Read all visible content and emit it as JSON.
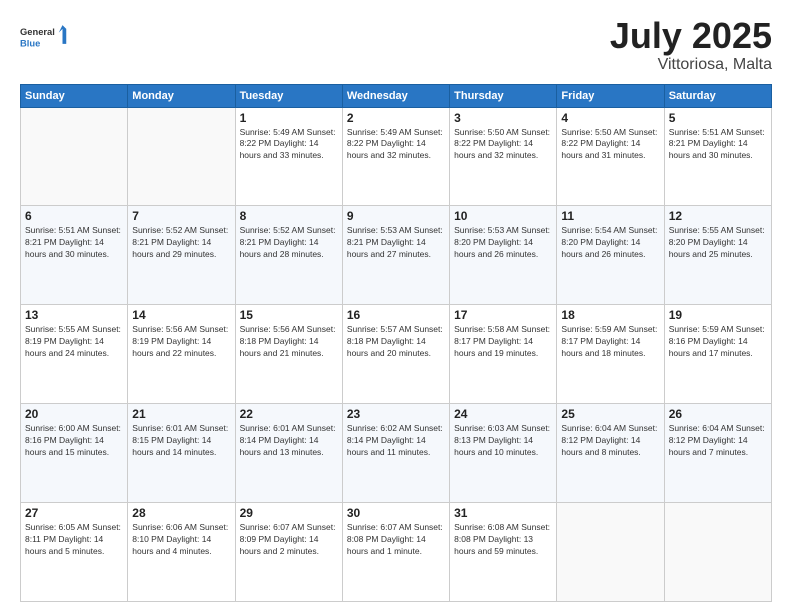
{
  "header": {
    "logo_line1": "General",
    "logo_line2": "Blue",
    "month": "July 2025",
    "location": "Vittoriosa, Malta"
  },
  "weekdays": [
    "Sunday",
    "Monday",
    "Tuesday",
    "Wednesday",
    "Thursday",
    "Friday",
    "Saturday"
  ],
  "weeks": [
    [
      {
        "day": "",
        "info": ""
      },
      {
        "day": "",
        "info": ""
      },
      {
        "day": "1",
        "info": "Sunrise: 5:49 AM\nSunset: 8:22 PM\nDaylight: 14 hours\nand 33 minutes."
      },
      {
        "day": "2",
        "info": "Sunrise: 5:49 AM\nSunset: 8:22 PM\nDaylight: 14 hours\nand 32 minutes."
      },
      {
        "day": "3",
        "info": "Sunrise: 5:50 AM\nSunset: 8:22 PM\nDaylight: 14 hours\nand 32 minutes."
      },
      {
        "day": "4",
        "info": "Sunrise: 5:50 AM\nSunset: 8:22 PM\nDaylight: 14 hours\nand 31 minutes."
      },
      {
        "day": "5",
        "info": "Sunrise: 5:51 AM\nSunset: 8:21 PM\nDaylight: 14 hours\nand 30 minutes."
      }
    ],
    [
      {
        "day": "6",
        "info": "Sunrise: 5:51 AM\nSunset: 8:21 PM\nDaylight: 14 hours\nand 30 minutes."
      },
      {
        "day": "7",
        "info": "Sunrise: 5:52 AM\nSunset: 8:21 PM\nDaylight: 14 hours\nand 29 minutes."
      },
      {
        "day": "8",
        "info": "Sunrise: 5:52 AM\nSunset: 8:21 PM\nDaylight: 14 hours\nand 28 minutes."
      },
      {
        "day": "9",
        "info": "Sunrise: 5:53 AM\nSunset: 8:21 PM\nDaylight: 14 hours\nand 27 minutes."
      },
      {
        "day": "10",
        "info": "Sunrise: 5:53 AM\nSunset: 8:20 PM\nDaylight: 14 hours\nand 26 minutes."
      },
      {
        "day": "11",
        "info": "Sunrise: 5:54 AM\nSunset: 8:20 PM\nDaylight: 14 hours\nand 26 minutes."
      },
      {
        "day": "12",
        "info": "Sunrise: 5:55 AM\nSunset: 8:20 PM\nDaylight: 14 hours\nand 25 minutes."
      }
    ],
    [
      {
        "day": "13",
        "info": "Sunrise: 5:55 AM\nSunset: 8:19 PM\nDaylight: 14 hours\nand 24 minutes."
      },
      {
        "day": "14",
        "info": "Sunrise: 5:56 AM\nSunset: 8:19 PM\nDaylight: 14 hours\nand 22 minutes."
      },
      {
        "day": "15",
        "info": "Sunrise: 5:56 AM\nSunset: 8:18 PM\nDaylight: 14 hours\nand 21 minutes."
      },
      {
        "day": "16",
        "info": "Sunrise: 5:57 AM\nSunset: 8:18 PM\nDaylight: 14 hours\nand 20 minutes."
      },
      {
        "day": "17",
        "info": "Sunrise: 5:58 AM\nSunset: 8:17 PM\nDaylight: 14 hours\nand 19 minutes."
      },
      {
        "day": "18",
        "info": "Sunrise: 5:59 AM\nSunset: 8:17 PM\nDaylight: 14 hours\nand 18 minutes."
      },
      {
        "day": "19",
        "info": "Sunrise: 5:59 AM\nSunset: 8:16 PM\nDaylight: 14 hours\nand 17 minutes."
      }
    ],
    [
      {
        "day": "20",
        "info": "Sunrise: 6:00 AM\nSunset: 8:16 PM\nDaylight: 14 hours\nand 15 minutes."
      },
      {
        "day": "21",
        "info": "Sunrise: 6:01 AM\nSunset: 8:15 PM\nDaylight: 14 hours\nand 14 minutes."
      },
      {
        "day": "22",
        "info": "Sunrise: 6:01 AM\nSunset: 8:14 PM\nDaylight: 14 hours\nand 13 minutes."
      },
      {
        "day": "23",
        "info": "Sunrise: 6:02 AM\nSunset: 8:14 PM\nDaylight: 14 hours\nand 11 minutes."
      },
      {
        "day": "24",
        "info": "Sunrise: 6:03 AM\nSunset: 8:13 PM\nDaylight: 14 hours\nand 10 minutes."
      },
      {
        "day": "25",
        "info": "Sunrise: 6:04 AM\nSunset: 8:12 PM\nDaylight: 14 hours\nand 8 minutes."
      },
      {
        "day": "26",
        "info": "Sunrise: 6:04 AM\nSunset: 8:12 PM\nDaylight: 14 hours\nand 7 minutes."
      }
    ],
    [
      {
        "day": "27",
        "info": "Sunrise: 6:05 AM\nSunset: 8:11 PM\nDaylight: 14 hours\nand 5 minutes."
      },
      {
        "day": "28",
        "info": "Sunrise: 6:06 AM\nSunset: 8:10 PM\nDaylight: 14 hours\nand 4 minutes."
      },
      {
        "day": "29",
        "info": "Sunrise: 6:07 AM\nSunset: 8:09 PM\nDaylight: 14 hours\nand 2 minutes."
      },
      {
        "day": "30",
        "info": "Sunrise: 6:07 AM\nSunset: 8:08 PM\nDaylight: 14 hours\nand 1 minute."
      },
      {
        "day": "31",
        "info": "Sunrise: 6:08 AM\nSunset: 8:08 PM\nDaylight: 13 hours\nand 59 minutes."
      },
      {
        "day": "",
        "info": ""
      },
      {
        "day": "",
        "info": ""
      }
    ]
  ]
}
